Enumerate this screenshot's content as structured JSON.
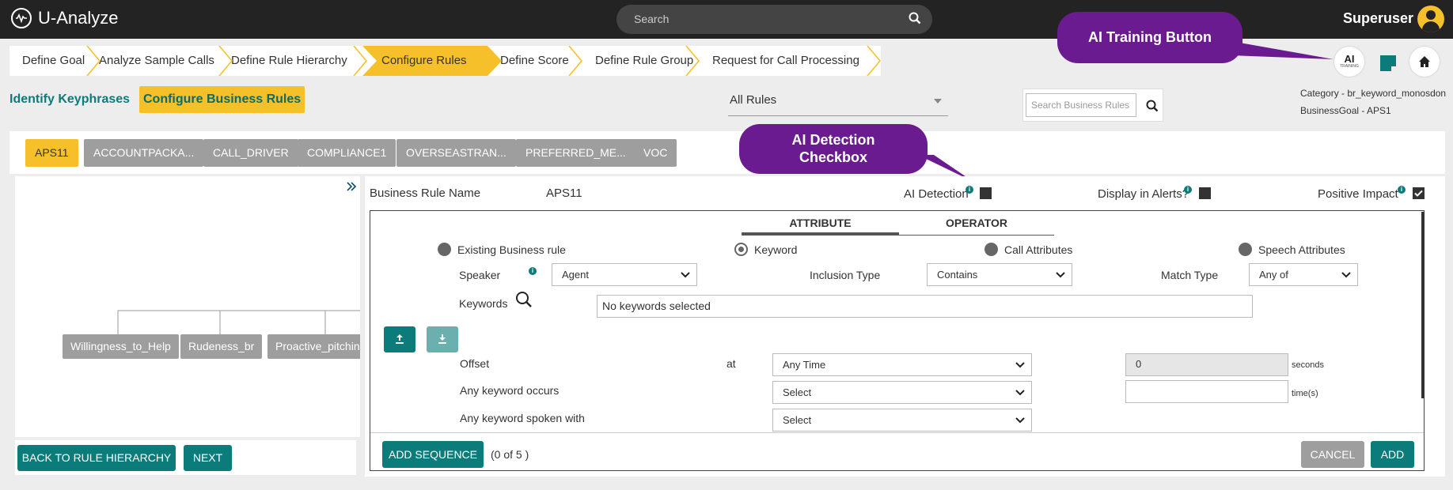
{
  "app": {
    "title": "U-Analyze"
  },
  "search": {
    "placeholder": "Search"
  },
  "user": {
    "name": "Superuser"
  },
  "wizard": {
    "steps": [
      "Define Goal",
      "Analyze Sample Calls",
      "Define Rule Hierarchy",
      "Configure Rules",
      "Define Score",
      "Define Rule Group",
      "Request for Call Processing"
    ],
    "active_index": 3
  },
  "top_right": {
    "ai_button": {
      "label": "AI",
      "sub": "TRAINING"
    }
  },
  "callouts": {
    "ai_training": "AI Training Button",
    "ai_detection_line1": "AI Detection",
    "ai_detection_line2": "Checkbox"
  },
  "subnav": {
    "identify": "Identify Keyphrases",
    "configure": "Configure Business Rules"
  },
  "rules_filter": {
    "value": "All Rules"
  },
  "search_rules": {
    "placeholder": "Search Business Rules"
  },
  "category": {
    "line1": "Category - br_keyword_monosdon",
    "line2": "BusinessGoal - APS1"
  },
  "chips": [
    "APS11",
    "ACCOUNTPACKA...",
    "CALL_DRIVER",
    "COMPLIANCE1",
    "OVERSEASTRAN...",
    "PREFERRED_ME...",
    "VOC"
  ],
  "tree": {
    "nodes": [
      "Willingness_to_Help",
      "Rudeness_br",
      "Proactive_pitching"
    ]
  },
  "left_buttons": {
    "back": "BACK TO RULE HIERARCHY",
    "next": "NEXT"
  },
  "rule": {
    "name_label": "Business Rule Name",
    "name_value": "APS11",
    "ai_detection_label": "AI Detection",
    "ai_detection_checked": false,
    "display_alerts_label": "Display in Alerts?",
    "display_alerts_checked": false,
    "positive_impact_label": "Positive Impact",
    "positive_impact_checked": true
  },
  "tabs": {
    "attribute": "ATTRIBUTE",
    "operator": "OPERATOR",
    "active": "attribute"
  },
  "radios": {
    "existing": "Existing Business rule",
    "keyword": "Keyword",
    "call_attributes": "Call Attributes",
    "speech_attributes": "Speech Attributes",
    "selected": "keyword"
  },
  "form": {
    "speaker_label": "Speaker",
    "speaker_value": "Agent",
    "inclusion_label": "Inclusion Type",
    "inclusion_value": "Contains",
    "match_label": "Match Type",
    "match_value": "Any of",
    "keywords_label": "Keywords",
    "keywords_value": "No keywords selected",
    "offset_label": "Offset",
    "at_label": "at",
    "offset_value": "Any Time",
    "offset_seconds": "0",
    "seconds_unit": "seconds",
    "occurs_label": "Any keyword occurs",
    "occurs_value": "Select",
    "times_unit": "time(s)",
    "spoken_label": "Any keyword spoken with",
    "spoken_value": "Select"
  },
  "bottom": {
    "add_sequence": "ADD SEQUENCE",
    "count": "(0 of 5 )",
    "cancel": "CANCEL",
    "add": "ADD"
  }
}
